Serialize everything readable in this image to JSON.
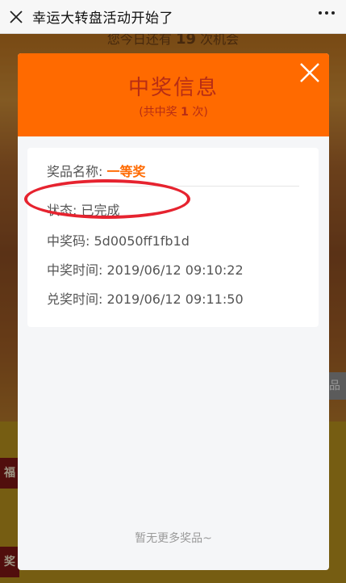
{
  "nav": {
    "title": "幸运大转盘活动开始了"
  },
  "background": {
    "top_text_prefix": "您今日还有",
    "top_text_count": "19",
    "top_text_suffix": "次机会",
    "side_button": "品",
    "tab_labels": [
      "福",
      "奖"
    ]
  },
  "modal": {
    "title": "中奖信息",
    "subtitle_prefix": "(共中奖",
    "subtitle_count": "1",
    "subtitle_suffix": "次)",
    "prize": {
      "name_label": "奖品名称:",
      "name_value": "一等奖",
      "status_label": "状态:",
      "status_value": "已完成",
      "code_label": "中奖码:",
      "code_value": "5d0050ff1fb1d",
      "win_time_label": "中奖时间:",
      "win_time_value": "2019/06/12 09:10:22",
      "redeem_time_label": "兑奖时间:",
      "redeem_time_value": "2019/06/12 09:11:50"
    },
    "footer": "暂无更多奖品~"
  },
  "colors": {
    "header": "#ff6a00",
    "title_text": "#b72d15",
    "highlight": "#ff6a00",
    "annotation": "#e6232f"
  }
}
